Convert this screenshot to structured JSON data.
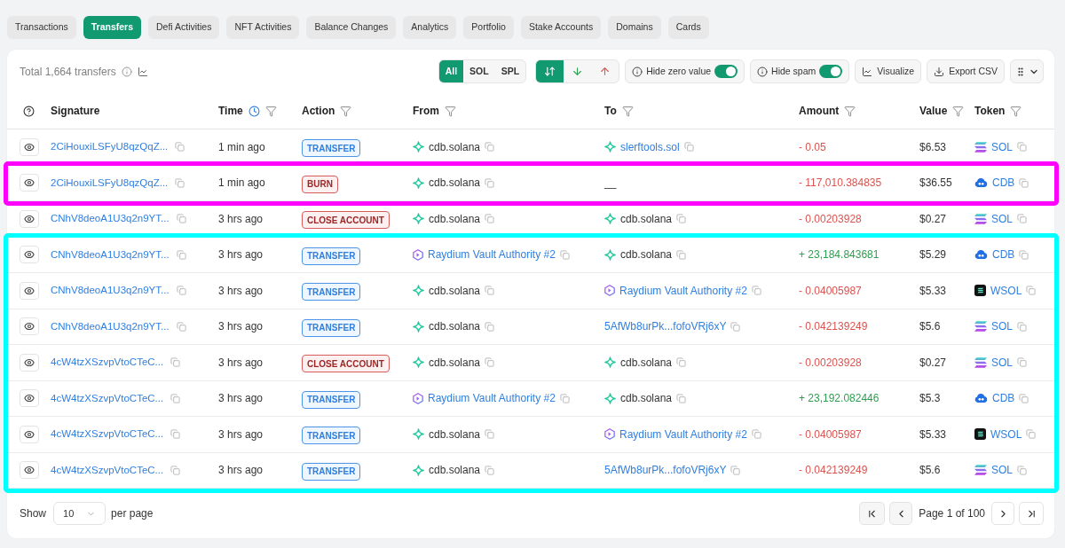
{
  "tabs": [
    {
      "label": "Transactions",
      "selected": false
    },
    {
      "label": "Transfers",
      "selected": true
    },
    {
      "label": "Defi Activities",
      "selected": false
    },
    {
      "label": "NFT Activities",
      "selected": false
    },
    {
      "label": "Balance Changes",
      "selected": false
    },
    {
      "label": "Analytics",
      "selected": false
    },
    {
      "label": "Portfolio",
      "selected": false
    },
    {
      "label": "Stake Accounts",
      "selected": false
    },
    {
      "label": "Domains",
      "selected": false
    },
    {
      "label": "Cards",
      "selected": false
    }
  ],
  "toolbar": {
    "total": "Total 1,664 transfers",
    "token_filter": [
      {
        "label": "All",
        "selected": true
      },
      {
        "label": "SOL",
        "selected": false
      },
      {
        "label": "SPL",
        "selected": false
      }
    ],
    "direction_filter": [
      {
        "kind": "both",
        "selected": true
      },
      {
        "kind": "in",
        "selected": false
      },
      {
        "kind": "out",
        "selected": false
      }
    ],
    "toggles": [
      {
        "label": "Hide zero value",
        "on": true
      },
      {
        "label": "Hide spam",
        "on": true
      }
    ],
    "buttons": [
      {
        "label": "Visualize",
        "kind": "chart"
      },
      {
        "label": "Export CSV",
        "kind": "export"
      }
    ]
  },
  "table": {
    "columns": [
      {
        "label": "Signature",
        "clock": false,
        "filter": false
      },
      {
        "label": "Time",
        "clock": true,
        "filter": true
      },
      {
        "label": "Action",
        "clock": false,
        "filter": true
      },
      {
        "label": "From",
        "clock": false,
        "filter": true
      },
      {
        "label": "To",
        "clock": false,
        "filter": true
      },
      {
        "label": "Amount",
        "clock": false,
        "filter": true
      },
      {
        "label": "Value",
        "clock": false,
        "filter": true
      },
      {
        "label": "Token",
        "clock": false,
        "filter": true
      }
    ],
    "row_groups": [
      {
        "rows": [
          {
            "signature": "2CiHouxiLSFyU8qzQqZ...",
            "time": "1 min ago",
            "action": {
              "label": "TRANSFER",
              "kind": "transfer"
            },
            "from": {
              "kind": "domain",
              "text": "cdb.solana",
              "linked": false
            },
            "to": {
              "kind": "domain",
              "text": "slerftools.sol",
              "linked": true
            },
            "amount": {
              "text": "- 0.05",
              "kind": "out"
            },
            "value": "$6.53",
            "token": {
              "symbol": "SOL",
              "kind": "sol"
            }
          }
        ]
      },
      {
        "color": "#ff00ff",
        "rows": [
          {
            "signature": "2CiHouxiLSFyU8qzQqZ...",
            "time": "1 min ago",
            "action": {
              "label": "BURN",
              "kind": "burn"
            },
            "from": {
              "kind": "domain",
              "text": "cdb.solana",
              "linked": false
            },
            "to": {
              "kind": "none",
              "text": "__",
              "linked": false
            },
            "amount": {
              "text": "- 117,010.384835",
              "kind": "out"
            },
            "value": "$36.55",
            "token": {
              "symbol": "CDB",
              "kind": "cdb"
            }
          }
        ]
      },
      {
        "rows": [
          {
            "signature": "CNhV8deoA1U3q2n9YT...",
            "time": "3 hrs ago",
            "action": {
              "label": "CLOSE ACCOUNT",
              "kind": "close_account"
            },
            "from": {
              "kind": "domain",
              "text": "cdb.solana",
              "linked": false
            },
            "to": {
              "kind": "domain",
              "text": "cdb.solana",
              "linked": false
            },
            "amount": {
              "text": "- 0.00203928",
              "kind": "out"
            },
            "value": "$0.27",
            "token": {
              "symbol": "SOL",
              "kind": "sol"
            }
          }
        ]
      },
      {
        "color": "#00ffff",
        "rows": [
          {
            "signature": "CNhV8deoA1U3q2n9YT...",
            "time": "3 hrs ago",
            "action": {
              "label": "TRANSFER",
              "kind": "transfer"
            },
            "from": {
              "kind": "program",
              "text": "Raydium Vault Authority #2",
              "linked": true
            },
            "to": {
              "kind": "domain",
              "text": "cdb.solana",
              "linked": false
            },
            "amount": {
              "text": "+ 23,184.843681",
              "kind": "in"
            },
            "value": "$5.29",
            "token": {
              "symbol": "CDB",
              "kind": "cdb"
            }
          },
          {
            "signature": "CNhV8deoA1U3q2n9YT...",
            "time": "3 hrs ago",
            "action": {
              "label": "TRANSFER",
              "kind": "transfer"
            },
            "from": {
              "kind": "domain",
              "text": "cdb.solana",
              "linked": false
            },
            "to": {
              "kind": "program",
              "text": "Raydium Vault Authority #2",
              "linked": true
            },
            "amount": {
              "text": "- 0.04005987",
              "kind": "out"
            },
            "value": "$5.33",
            "token": {
              "symbol": "WSOL",
              "kind": "wsol"
            }
          },
          {
            "signature": "CNhV8deoA1U3q2n9YT...",
            "time": "3 hrs ago",
            "action": {
              "label": "TRANSFER",
              "kind": "transfer"
            },
            "from": {
              "kind": "domain",
              "text": "cdb.solana",
              "linked": false
            },
            "to": {
              "kind": "address",
              "text": "5AfWb8urPk...fofoVRj6xY",
              "linked": true
            },
            "amount": {
              "text": "- 0.042139249",
              "kind": "out"
            },
            "value": "$5.6",
            "token": {
              "symbol": "SOL",
              "kind": "sol"
            }
          },
          {
            "signature": "4cW4tzXSzvpVtoCTeC...",
            "time": "3 hrs ago",
            "action": {
              "label": "CLOSE ACCOUNT",
              "kind": "close_account"
            },
            "from": {
              "kind": "domain",
              "text": "cdb.solana",
              "linked": false
            },
            "to": {
              "kind": "domain",
              "text": "cdb.solana",
              "linked": false
            },
            "amount": {
              "text": "- 0.00203928",
              "kind": "out"
            },
            "value": "$0.27",
            "token": {
              "symbol": "SOL",
              "kind": "sol"
            }
          },
          {
            "signature": "4cW4tzXSzvpVtoCTeC...",
            "time": "3 hrs ago",
            "action": {
              "label": "TRANSFER",
              "kind": "transfer"
            },
            "from": {
              "kind": "program",
              "text": "Raydium Vault Authority #2",
              "linked": true
            },
            "to": {
              "kind": "domain",
              "text": "cdb.solana",
              "linked": false
            },
            "amount": {
              "text": "+ 23,192.082446",
              "kind": "in"
            },
            "value": "$5.3",
            "token": {
              "symbol": "CDB",
              "kind": "cdb"
            }
          },
          {
            "signature": "4cW4tzXSzvpVtoCTeC...",
            "time": "3 hrs ago",
            "action": {
              "label": "TRANSFER",
              "kind": "transfer"
            },
            "from": {
              "kind": "domain",
              "text": "cdb.solana",
              "linked": false
            },
            "to": {
              "kind": "program",
              "text": "Raydium Vault Authority #2",
              "linked": true
            },
            "amount": {
              "text": "- 0.04005987",
              "kind": "out"
            },
            "value": "$5.33",
            "token": {
              "symbol": "WSOL",
              "kind": "wsol"
            }
          },
          {
            "signature": "4cW4tzXSzvpVtoCTeC...",
            "time": "3 hrs ago",
            "action": {
              "label": "TRANSFER",
              "kind": "transfer"
            },
            "from": {
              "kind": "domain",
              "text": "cdb.solana",
              "linked": false
            },
            "to": {
              "kind": "address",
              "text": "5AfWb8urPk...fofoVRj6xY",
              "linked": true
            },
            "amount": {
              "text": "- 0.042139249",
              "kind": "out"
            },
            "value": "$5.6",
            "token": {
              "symbol": "SOL",
              "kind": "sol"
            }
          }
        ]
      }
    ]
  },
  "footer": {
    "show_label": "Show",
    "page_size": "10",
    "per_page_label": "per page",
    "page_info": "Page 1 of 100"
  }
}
